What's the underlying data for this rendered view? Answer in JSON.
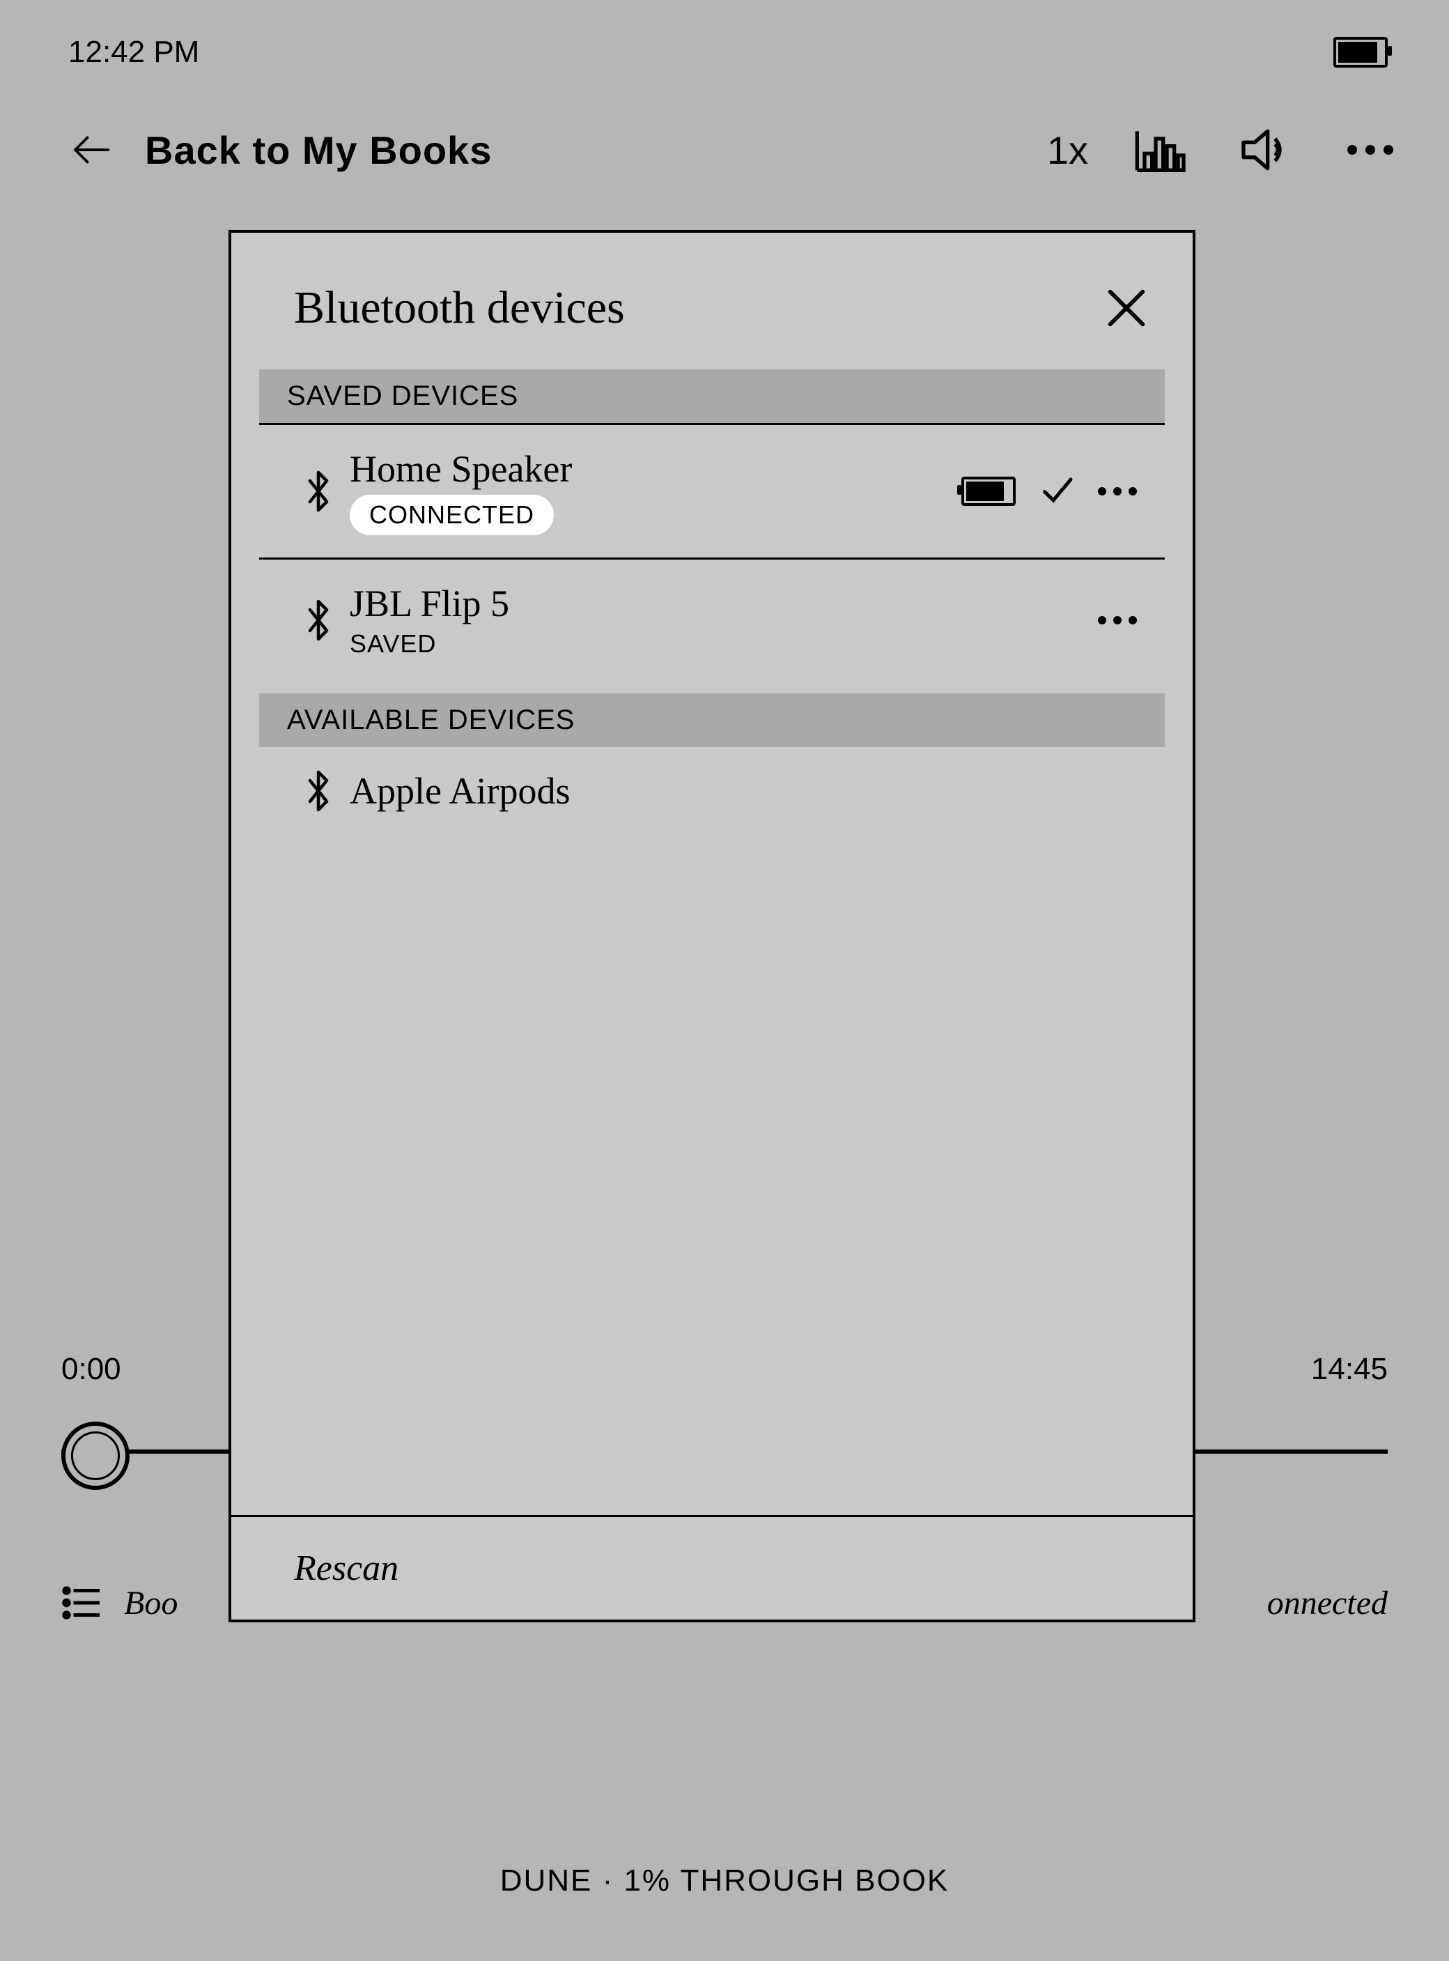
{
  "status": {
    "time": "12:42 PM"
  },
  "toolbar": {
    "back_label": "Back to My Books",
    "speed": "1x"
  },
  "player": {
    "elapsed": "0:00",
    "remaining": "14:45"
  },
  "bottombar": {
    "left_partial": "Boo",
    "right_partial": "onnected"
  },
  "footer": "DUNE · 1% THROUGH BOOK",
  "modal": {
    "title": "Bluetooth devices",
    "saved_header": "SAVED DEVICES",
    "available_header": "AVAILABLE DEVICES",
    "rescan": "Rescan",
    "saved": [
      {
        "name": "Home Speaker",
        "status": "CONNECTED",
        "connected": true
      },
      {
        "name": "JBL Flip 5",
        "status": "SAVED",
        "connected": false
      }
    ],
    "available": [
      {
        "name": "Apple Airpods"
      }
    ]
  }
}
